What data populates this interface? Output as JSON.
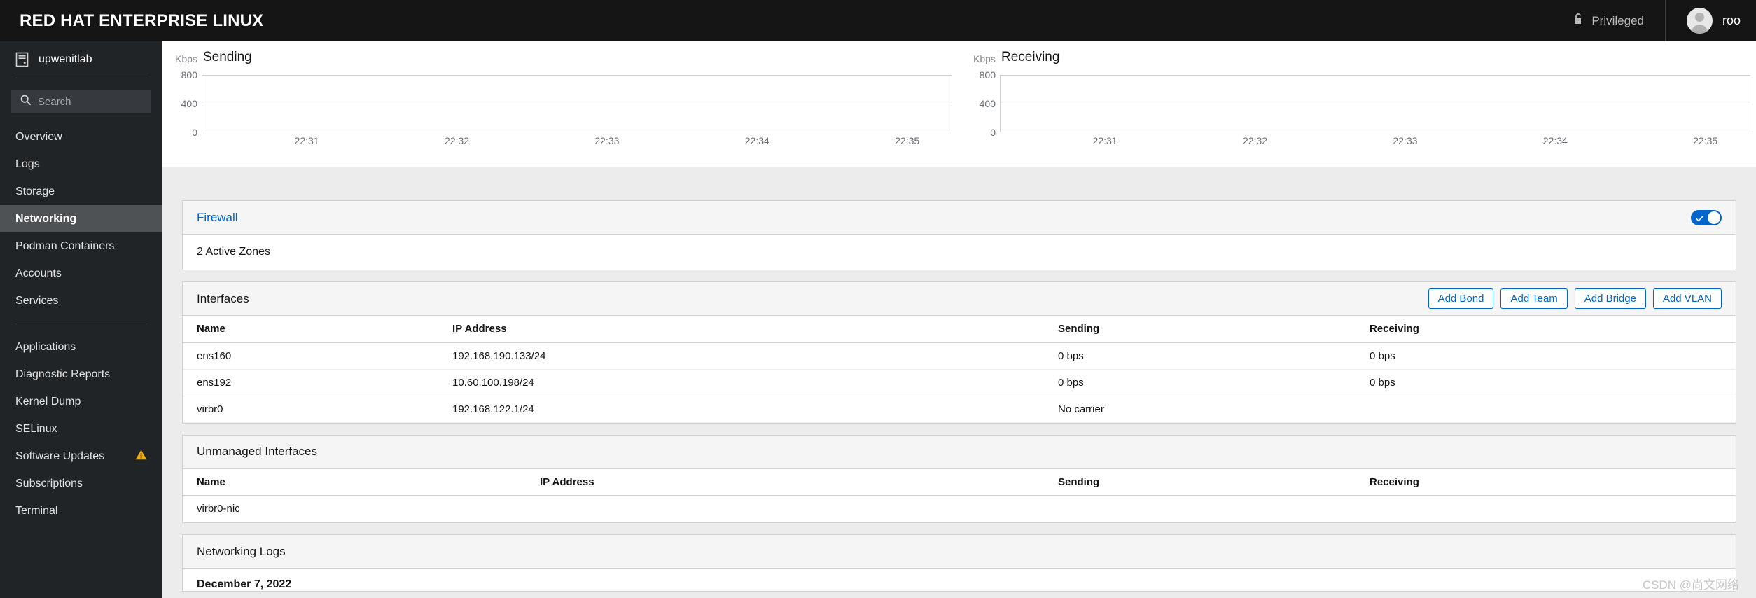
{
  "masthead": {
    "brand": "RED HAT ENTERPRISE LINUX",
    "privileged_label": "Privileged",
    "privileged_icon": "unlock-icon",
    "user_name": "roo",
    "avatar_icon": "user-avatar-icon"
  },
  "sidebar": {
    "host_name": "upwenitlab",
    "host_icon": "server-icon",
    "search": {
      "placeholder": "Search",
      "value": "",
      "icon": "search-icon"
    },
    "groups": [
      {
        "items": [
          {
            "label": "Overview",
            "active": false
          },
          {
            "label": "Logs",
            "active": false
          },
          {
            "label": "Storage",
            "active": false
          },
          {
            "label": "Networking",
            "active": true
          },
          {
            "label": "Podman Containers",
            "active": false
          },
          {
            "label": "Accounts",
            "active": false
          },
          {
            "label": "Services",
            "active": false
          }
        ]
      },
      {
        "items": [
          {
            "label": "Applications",
            "active": false
          },
          {
            "label": "Diagnostic Reports",
            "active": false
          },
          {
            "label": "Kernel Dump",
            "active": false
          },
          {
            "label": "SELinux",
            "active": false
          },
          {
            "label": "Software Updates",
            "active": false,
            "badge_icon": "warning-triangle-icon"
          },
          {
            "label": "Subscriptions",
            "active": false
          },
          {
            "label": "Terminal",
            "active": false
          }
        ]
      }
    ]
  },
  "chart_data": [
    {
      "type": "line",
      "title": "Sending",
      "ylabel": "Kbps",
      "xlabel": "",
      "ylim": [
        0,
        800
      ],
      "yticks": [
        0,
        400,
        800
      ],
      "xticks": [
        "22:31",
        "22:32",
        "22:33",
        "22:34",
        "22:35"
      ],
      "grid": true,
      "series": [
        {
          "name": "Sending",
          "values": [
            0,
            0,
            0,
            0,
            0
          ]
        }
      ]
    },
    {
      "type": "line",
      "title": "Receiving",
      "ylabel": "Kbps",
      "xlabel": "",
      "ylim": [
        0,
        800
      ],
      "yticks": [
        0,
        400,
        800
      ],
      "xticks": [
        "22:31",
        "22:32",
        "22:33",
        "22:34",
        "22:35"
      ],
      "grid": true,
      "series": [
        {
          "name": "Receiving",
          "values": [
            0,
            0,
            0,
            0,
            0
          ]
        }
      ]
    }
  ],
  "firewall": {
    "title": "Firewall",
    "status_text": "2 Active Zones",
    "toggle_on": true,
    "accent_color": "#0066cc"
  },
  "interfaces": {
    "title": "Interfaces",
    "actions": [
      {
        "label": "Add Bond"
      },
      {
        "label": "Add Team"
      },
      {
        "label": "Add Bridge"
      },
      {
        "label": "Add VLAN"
      }
    ],
    "columns": [
      "Name",
      "IP Address",
      "Sending",
      "Receiving"
    ],
    "rows": [
      {
        "name": "ens160",
        "ip": "192.168.190.133/24",
        "sending": "0 bps",
        "receiving": "0 bps"
      },
      {
        "name": "ens192",
        "ip": "10.60.100.198/24",
        "sending": "0 bps",
        "receiving": "0 bps"
      },
      {
        "name": "virbr0",
        "ip": "192.168.122.1/24",
        "sending": "No carrier",
        "receiving": ""
      }
    ]
  },
  "unmanaged": {
    "title": "Unmanaged Interfaces",
    "columns": [
      "Name",
      "IP Address",
      "Sending",
      "Receiving"
    ],
    "rows": [
      {
        "name": "virbr0-nic",
        "ip": "",
        "sending": "",
        "receiving": ""
      }
    ]
  },
  "logs": {
    "title": "Networking Logs",
    "first_entry_date": "December 7, 2022"
  },
  "watermark": "CSDN @尚文网络"
}
